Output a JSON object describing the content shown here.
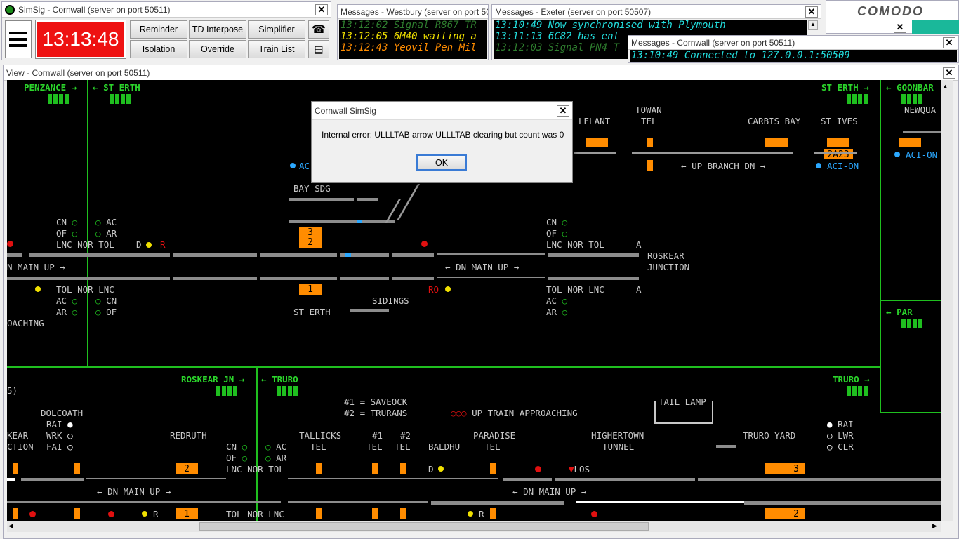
{
  "main_window": {
    "title": "SimSig - Cornwall (server on port 50511)",
    "clock": "13:13:48",
    "buttons": [
      "Reminder",
      "TD Interpose",
      "Simplifier",
      "Isolation",
      "Override",
      "Train List"
    ],
    "colors": {
      "clock_bg": "#ee1111"
    }
  },
  "msg_westbury": {
    "title": "Messages - Westbury (server on port 505",
    "lines": [
      {
        "text": "13:12:02 Signal R867 TR",
        "color": "#2e7d2e"
      },
      {
        "text": "13:12:05 6M40 waiting a",
        "color": "#f0e000"
      },
      {
        "text": "13:12:43 Yeovil Pen Mil",
        "color": "#ff8c00"
      }
    ]
  },
  "msg_exeter": {
    "title": "Messages - Exeter (server on port 50507)",
    "lines": [
      {
        "text": "13:10:49 Now synchronised with Plymouth",
        "color": "#22dddd"
      },
      {
        "text": "13:11:13 6C82 has ent",
        "color": "#22dddd"
      },
      {
        "text": "13:12:03 Signal PN4 T",
        "color": "#2e7d2e"
      }
    ]
  },
  "msg_cornwall": {
    "title": "Messages - Cornwall (server on port 50511)",
    "lines": [
      {
        "text": "13:10:49 Connected to 127.0.0.1:50509",
        "color": "#22dddd"
      }
    ]
  },
  "comodo": {
    "label": "COMODO"
  },
  "view_window": {
    "title": "View - Cornwall (server on port 50511)"
  },
  "dialog": {
    "title": "Cornwall SimSig",
    "message": "Internal error: ULLLTAB arrow ULLLTAB clearing but count was 0",
    "ok": "OK"
  },
  "panel": {
    "exits": {
      "penzance": "PENZANCE",
      "st_erth_top": "ST ERTH",
      "st_erth_right": "ST ERTH",
      "goonbarrow": "GOONBAR",
      "newquay": "NEWQUA",
      "par": "PAR",
      "roskear_jn": "ROSKEAR JN",
      "truro_mid": "TRURO",
      "truro_right": "TRURO"
    },
    "labels": {
      "lelant": "LELANT",
      "towan": "TOWAN",
      "towan_tel": "TEL",
      "carbis_bay": "CARBIS BAY",
      "st_ives": "ST IVES",
      "up_branch_dn": "UP BRANCH DN",
      "aci_on_1": "ACI-ON",
      "aci_on_2": "ACI-ON",
      "ac_partial": "AC",
      "bay_sdg": "BAY SDG",
      "n_main_up": "N MAIN UP",
      "dn_main_up_1": "DN MAIN UP",
      "roskear": "ROSKEAR",
      "junction": "JUNCTION",
      "st_erth": "ST ERTH",
      "sidings": "SIDINGS",
      "oaching": "OACHING",
      "cn": "CN",
      "of": "OF",
      "ac": "AC",
      "ar": "AR",
      "lnc": "LNC",
      "nor": "NOR",
      "tol": "TOL",
      "a": "A",
      "d": "D",
      "r": "R",
      "ro": "RO",
      "five": "5)",
      "dolcoath": "DOLCOATH",
      "rai": "RAI",
      "wrk": "WRK",
      "fai": "FAI",
      "kear": "KEAR",
      "ction": "CTION",
      "redruth": "REDRUTH",
      "key1": "#1 = SAVEOCK",
      "key2": "#2 = TRURANS",
      "up_train_approaching": "UP TRAIN APPROACHING",
      "tail_lamp": "TAIL LAMP",
      "tallicks": "TALLICKS",
      "tel": "TEL",
      "h1": "#1",
      "h2": "#2",
      "baldhu": "BALDHU",
      "paradise": "PARADISE",
      "highertown": "HIGHERTOWN",
      "tunnel": "TUNNEL",
      "truro_yard": "TRURO YARD",
      "lwr": "LWR",
      "clr": "CLR",
      "los": "LOS",
      "dn_main_up_2": "DN MAIN UP",
      "dn_main_up_3": "DN MAIN UP"
    },
    "berths": {
      "b_2a23": "2A23",
      "b_3": "3",
      "b_2": "2",
      "b_1": "1",
      "b_2_lower": "2",
      "b_1_lower": "1",
      "b_3_right": "3",
      "b_2_right": "2"
    },
    "colors": {
      "track": "#8c8c8c",
      "berth": "#ff8c00",
      "exit_green": "#1fbf1f",
      "signal_red": "#e01010"
    }
  }
}
